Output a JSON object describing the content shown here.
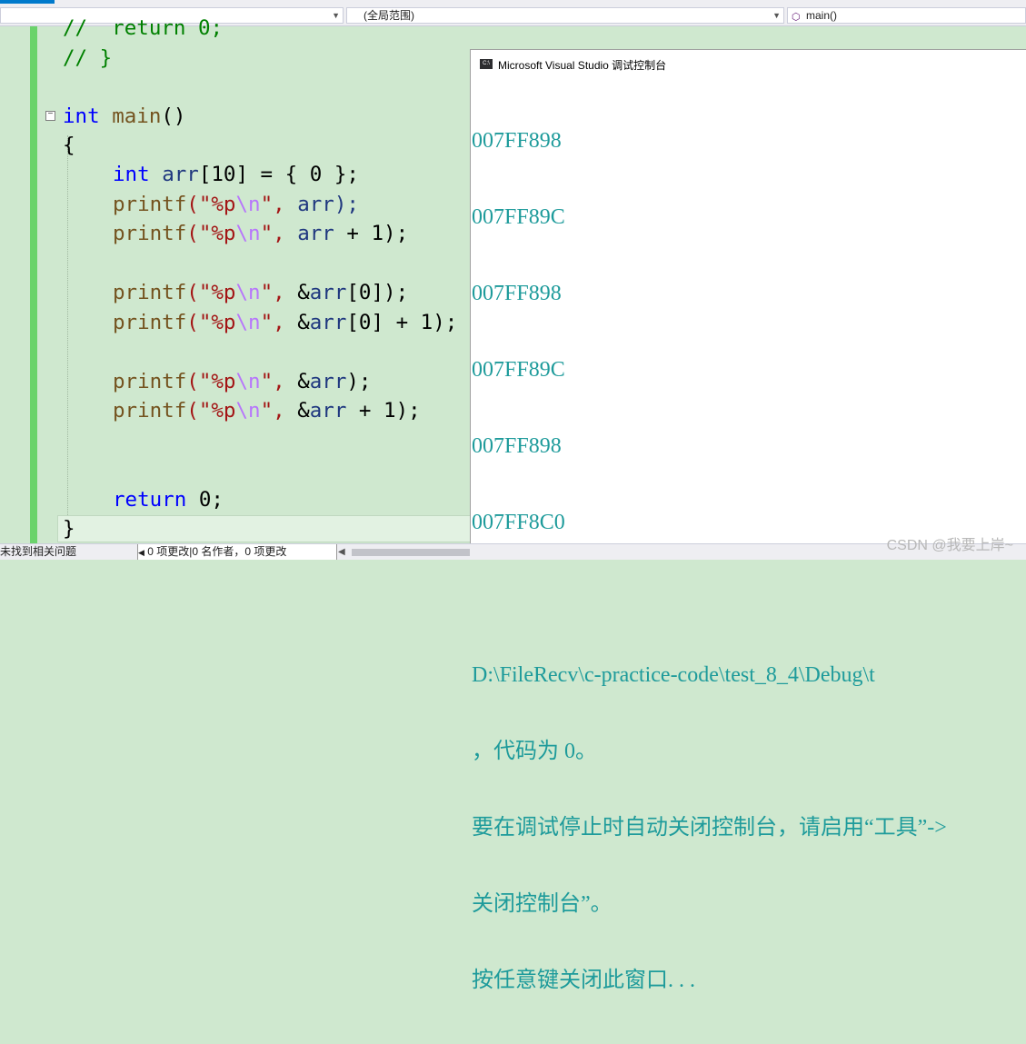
{
  "toolbar": {
    "project_selector": "",
    "scope_selector": "(全局范围)",
    "function_selector": "main()"
  },
  "code": {
    "l1_comment": "//  return 0;",
    "l2_comment": "// }",
    "main_kw": "int",
    "main_name": "main",
    "main_paren": "()",
    "open_brace": "{",
    "decl_kw": "int",
    "decl_var": "arr",
    "decl_rest": "[10] = { 0 };",
    "printf": "printf",
    "fmt_open": "(\"%p",
    "fmt_esc": "\\n",
    "fmt_close": "\",",
    "arg1": " arr);",
    "arg2_var": " arr",
    "arg2_rest": " + 1);",
    "arg3_amp": " &",
    "arg3_var": "arr",
    "arg3_rest": "[0]);",
    "arg4_rest": "[0] + 1);",
    "arg5_rest": ");",
    "arg6_rest": " + 1);",
    "ret_kw": "return",
    "ret_rest": " 0;",
    "close_brace": "}"
  },
  "console": {
    "title": "Microsoft Visual Studio 调试控制台",
    "icon_label": "C:\\",
    "lines": [
      "007FF898",
      "007FF89C",
      "007FF898",
      "007FF89C",
      "007FF898",
      "007FF8C0",
      "",
      "D:\\FileRecv\\c-practice-code\\test_8_4\\Debug\\t",
      "，代码为 0。",
      "要在调试停止时自动关闭控制台，请启用“工具”->",
      "关闭控制台”。",
      "按任意键关闭此窗口. . ."
    ]
  },
  "status": {
    "issues": "未找到相关问题",
    "changes": "0 项更改|0 名作者，0 项更改"
  },
  "watermark": "CSDN @我要上岸~",
  "colors": {
    "editor_bg": "#cfe8cf",
    "gutter_change": "#6bd36b",
    "console_text": "#1e9b9b",
    "keyword": "#0000ff"
  }
}
